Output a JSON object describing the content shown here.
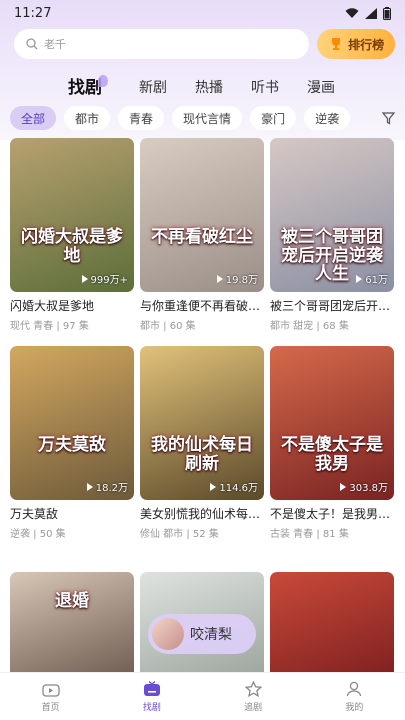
{
  "status_bar": {
    "time": "11:27"
  },
  "search": {
    "placeholder": "老千",
    "rank_label": "排行榜"
  },
  "nav_tabs": [
    {
      "label": "找剧",
      "active": true
    },
    {
      "label": "新剧"
    },
    {
      "label": "热播"
    },
    {
      "label": "听书"
    },
    {
      "label": "漫画"
    }
  ],
  "filter_chips": [
    {
      "label": "全部",
      "active": true
    },
    {
      "label": "都市"
    },
    {
      "label": "青春"
    },
    {
      "label": "现代言情"
    },
    {
      "label": "豪门"
    },
    {
      "label": "逆袭"
    }
  ],
  "cards": [
    {
      "name": "闪婚大叔是爹地",
      "tags": "现代 青春",
      "episodes": "97 集",
      "views": "999万+",
      "poster_text": "闪婚大叔是爹地",
      "colors": [
        "#5b6e3a",
        "#b8a170"
      ]
    },
    {
      "name": "与你重逢便不再看破…",
      "tags": "都市",
      "episodes": "60 集",
      "views": "19.8万",
      "poster_text": "不再看破红尘",
      "colors": [
        "#9a8f88",
        "#d9ccc1"
      ]
    },
    {
      "name": "被三个哥哥团宠后开…",
      "tags": "都市 甜宠",
      "episodes": "68 集",
      "views": "61万",
      "poster_text": "被三个哥哥团宠后开启逆袭人生",
      "colors": [
        "#8a8fa3",
        "#d6c8c4"
      ]
    },
    {
      "name": "万夫莫敌",
      "tags": "逆袭",
      "episodes": "50 集",
      "views": "18.2万",
      "poster_text": "万夫莫敌",
      "colors": [
        "#6d5a3a",
        "#d3a860"
      ]
    },
    {
      "name": "美女别慌我的仙术每…",
      "tags": "修仙 都市",
      "episodes": "52 集",
      "views": "114.6万",
      "poster_text": "我的仙术每日刷新",
      "colors": [
        "#5a4a2a",
        "#e2c27a"
      ]
    },
    {
      "name": "不是傻太子！是我男…",
      "tags": "古装 青春",
      "episodes": "81 集",
      "views": "303.8万",
      "poster_text": "不是傻太子是我男",
      "colors": [
        "#7a2323",
        "#d56a4a"
      ]
    },
    {
      "name": "",
      "tags": "",
      "episodes": "",
      "views": "",
      "poster_text": "退婚",
      "colors": [
        "#6b5a4e",
        "#d8c7b6"
      ]
    },
    {
      "name": "",
      "tags": "",
      "episodes": "",
      "views": "",
      "poster_text": "",
      "colors": [
        "#9aa39c",
        "#dfe3df"
      ]
    },
    {
      "name": "",
      "tags": "",
      "episodes": "",
      "views": "",
      "poster_text": "",
      "colors": [
        "#7d1f1f",
        "#c94a3a"
      ]
    }
  ],
  "floating": {
    "label": "咬清梨"
  },
  "bottom_nav": [
    {
      "label": "首页",
      "icon": "home-icon"
    },
    {
      "label": "找剧",
      "icon": "tv-icon",
      "active": true
    },
    {
      "label": "追剧",
      "icon": "star-icon"
    },
    {
      "label": "我的",
      "icon": "person-icon"
    }
  ],
  "colors": {
    "accent": "#6b4ed0",
    "rank_gold": "#ffb23e"
  }
}
